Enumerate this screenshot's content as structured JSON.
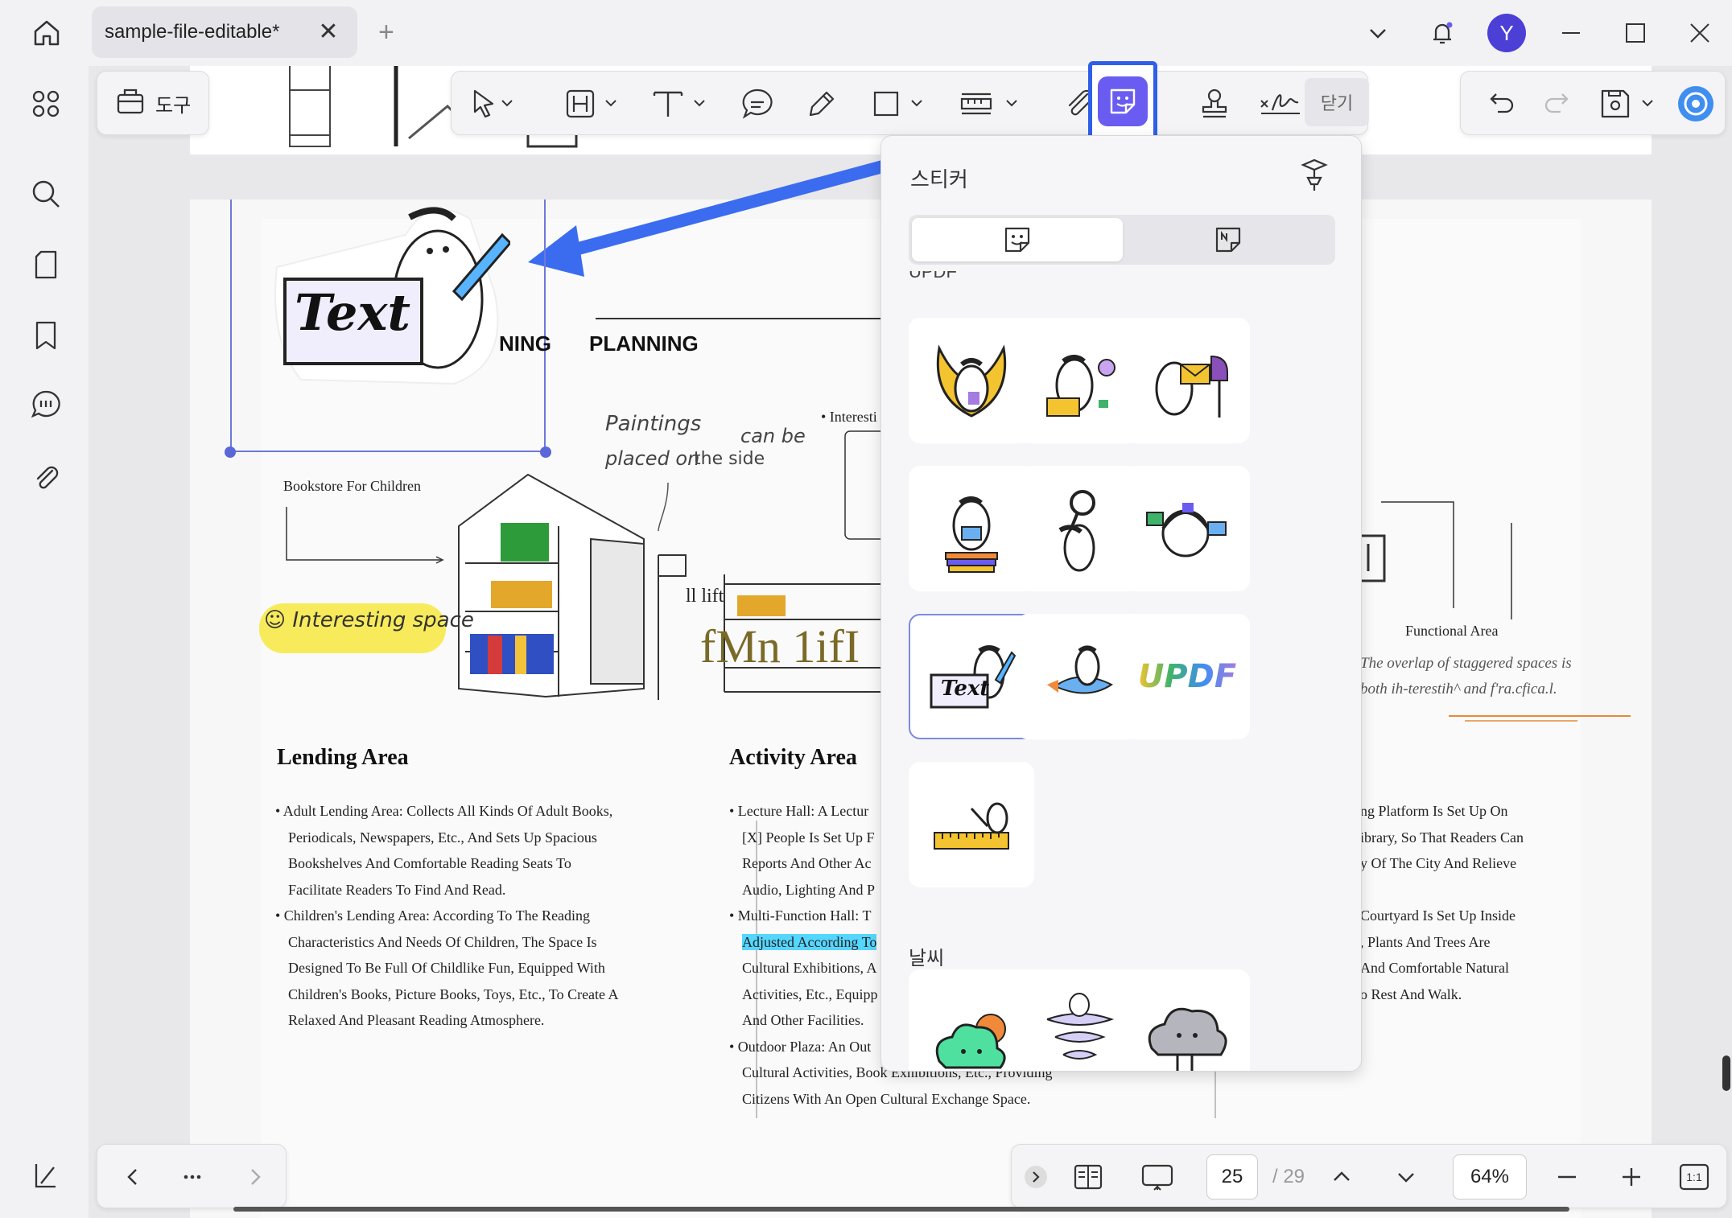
{
  "titlebar": {
    "tab_title": "sample-file-editable*",
    "avatar_letter": "Y"
  },
  "toolbar": {
    "tools_label": "도구",
    "close_label": "닫기"
  },
  "sticker_panel": {
    "title": "스티커",
    "section_partial": "UPDF",
    "section_weather": "날씨",
    "updf_sticker_text": "UPDF",
    "text_sticker_text": "Text"
  },
  "bottom_bar": {
    "current_page": "25",
    "total_pages": "/ 29",
    "zoom": "64%"
  },
  "document": {
    "planning_partial": "NING",
    "planning": "PLANNING",
    "sticker_text": "Text",
    "hand_paintings": "Paintings",
    "hand_can_be": "can be",
    "hand_placed": "placed on",
    "hand_side": "the side",
    "interesting_label": "• Interesti",
    "bookstore": "Bookstore For Children",
    "interesting_space": "Interesting space",
    "lift": "ll lift",
    "fmn": "fMn  1ifI",
    "functional_area": "Functional Area",
    "overlap_1": "The overlap of staggered spaces is",
    "overlap_2": "both ih-terestih^ and f'ra.cfica.l.",
    "lending_heading": "Lending Area",
    "activity_heading": "Activity Area",
    "lending_lines": [
      "• Adult Lending Area: Collects All Kinds Of Adult Books,",
      "Periodicals, Newspapers, Etc., And Sets Up Spacious",
      "Bookshelves And Comfortable Reading Seats To",
      "Facilitate Readers To Find And Read.",
      "• Children's Lending Area: According To The Reading",
      "Characteristics And Needs Of Children, The Space Is",
      "Designed To Be Full Of Childlike Fun, Equipped With",
      "Children's Books, Picture Books, Toys, Etc., To Create A",
      "Relaxed And Pleasant Reading Atmosphere."
    ],
    "activity_lines": [
      "• Lecture Hall: A Lectur",
      "[X] People Is Set Up F",
      "Reports And Other Ac",
      "Audio, Lighting And P",
      "• Multi-Function Hall: T",
      "Adjusted According To",
      "Cultural Exhibitions, A",
      "Activities, Etc., Equipp",
      "And Other Facilities.",
      "• Outdoor Plaza: An Out",
      "Cultural Activities, Book Exhibitions, Etc., Providing",
      "Citizens With An Open Cultural Exchange Space."
    ],
    "right_lines": [
      "ng Platform Is Set Up On",
      "ibrary, So That Readers Can",
      "y Of The City And Relieve",
      "",
      "Courtyard Is Set Up Inside",
      ", Plants And Trees Are",
      "And Comfortable Natural",
      "o Rest And Walk."
    ]
  }
}
